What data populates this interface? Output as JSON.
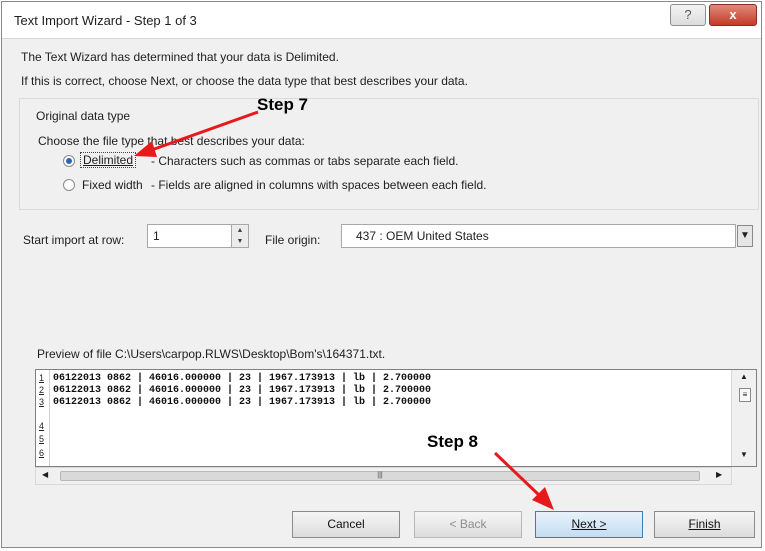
{
  "window": {
    "title": "Text Import Wizard - Step 1 of 3",
    "help_label": "?",
    "close_label": "x"
  },
  "intro": {
    "line1": "The Text Wizard has determined that your data is Delimited.",
    "line2": "If this is correct, choose Next, or choose the data type that best describes your data."
  },
  "original_type": {
    "group_title": "Original data type",
    "prompt": "Choose the file type that best describes your data:",
    "options": [
      {
        "label": "Delimited",
        "description": "- Characters such as commas or tabs separate each field.",
        "selected": true
      },
      {
        "label": "Fixed width",
        "description": "- Fields are aligned in columns with spaces between each field.",
        "selected": false
      }
    ]
  },
  "start_row": {
    "label": "Start import at row:",
    "value": "1"
  },
  "file_origin": {
    "label": "File origin:",
    "value": "437 : OEM United States"
  },
  "preview": {
    "label": "Preview of file C:\\Users\\carpop.RLWS\\Desktop\\Bom's\\164371.txt.",
    "rows": [
      {
        "num": "1",
        "text": "06122013 0862 | 46016.000000 | 23 | 1967.173913 | lb | 2.700000"
      },
      {
        "num": "2",
        "text": "06122013 0862 | 46016.000000 | 23 | 1967.173913 | lb | 2.700000"
      },
      {
        "num": "3",
        "text": "06122013 0862 | 46016.000000 | 23 | 1967.173913 | lb | 2.700000"
      },
      {
        "num": "4",
        "text": ""
      },
      {
        "num": "5",
        "text": ""
      },
      {
        "num": "6",
        "text": ""
      }
    ]
  },
  "buttons": {
    "cancel": "Cancel",
    "back": "< Back",
    "next": "Next >",
    "finish": "Finish"
  },
  "annotations": {
    "step7": "Step 7",
    "step8": "Step 8"
  },
  "colors": {
    "arrow": "#e8191d",
    "radio_selected": "#2a66b8",
    "close_button": "#c4392a"
  }
}
